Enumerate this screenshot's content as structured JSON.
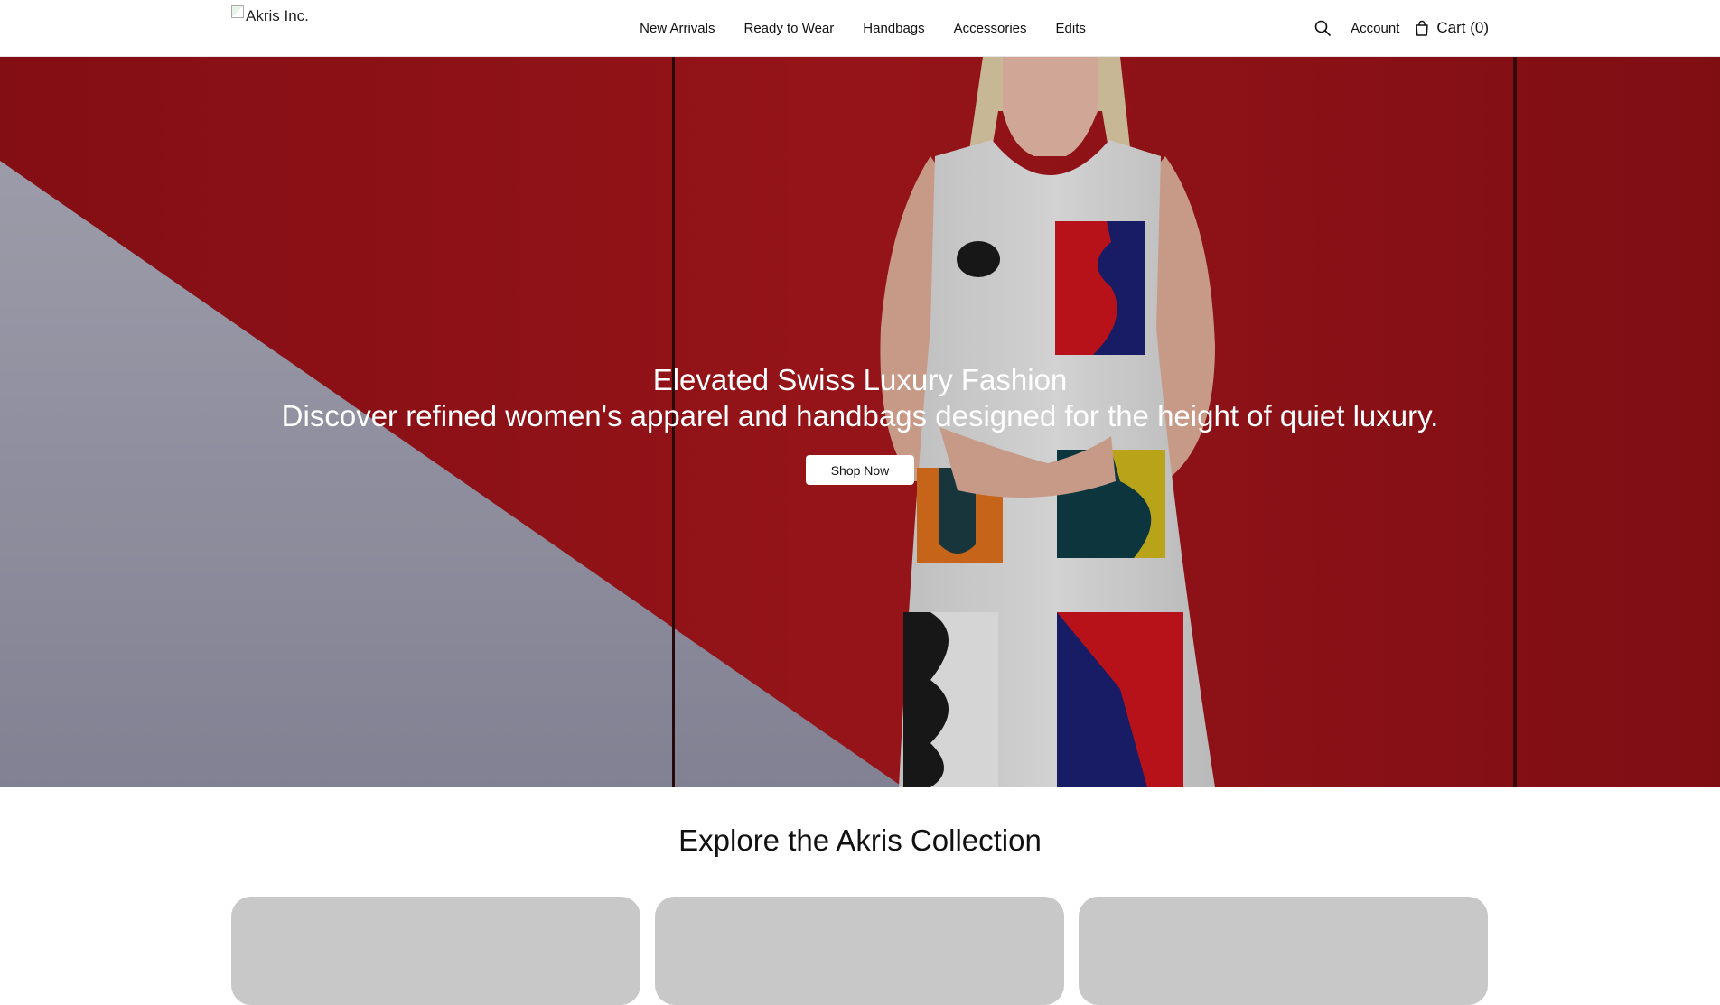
{
  "header": {
    "logo_alt": "Akris Inc.",
    "nav": [
      "New Arrivals",
      "Ready to Wear",
      "Handbags",
      "Accessories",
      "Edits"
    ],
    "account_label": "Account",
    "cart_label": "Cart (0)",
    "search_icon": "search-icon",
    "cart_icon": "shopping-bag-icon"
  },
  "hero": {
    "title": "Elevated Swiss Luxury Fashion",
    "subtitle": "Discover refined women's apparel and handbags designed for the height of quiet luxury.",
    "cta_label": "Shop Now"
  },
  "collection": {
    "title": "Explore the Akris Collection",
    "cards": [
      {},
      {},
      {}
    ]
  },
  "colors": {
    "hero_red": "#9b141a",
    "hero_grey": "#9f9fb0",
    "card_grey": "#c8c8c8"
  }
}
